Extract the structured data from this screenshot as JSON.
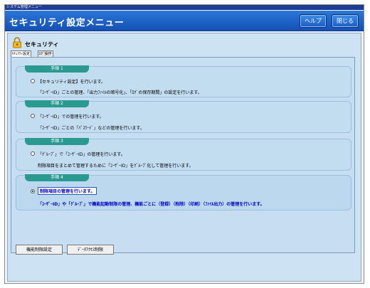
{
  "window": {
    "caption": "システム管理メニュー",
    "title": "セキュリティ設定メニュー"
  },
  "header": {
    "help_label": "ヘルプ",
    "close_label": "閉じる"
  },
  "section": {
    "title": "セキュリティ"
  },
  "tabs": [
    {
      "label": "ｾｷｭﾘﾃｨ設定"
    },
    {
      "label": "ﾛｸﾞ操作"
    }
  ],
  "steps": [
    {
      "tab": "手順 1",
      "line1": "【セキュリティ設定】を行います。",
      "line2": "「ﾕｰｻﾞｰID」ごとの管理、「出力ﾌｧｲﾙの暗号化」、「ﾛｸﾞの保存期間」の設定を行います。",
      "checked": false
    },
    {
      "tab": "手順 2",
      "line1": "「ﾕｰｻﾞｰID」での管理を行います。",
      "line2": "「ﾕｰｻﾞｰID」ごとの「ﾊﾟｽﾜｰﾄﾞ」などの管理を行います。",
      "checked": false
    },
    {
      "tab": "手順 3",
      "line1": "「ｸﾞﾙｰﾌﾟ」で「ﾕｰｻﾞｰID」の管理を行います。",
      "line2": "制限項目をまとめて管理するために「ﾕｰｻﾞｰID」をｸﾞﾙｰﾌﾟ化して管理を行います。",
      "checked": false
    },
    {
      "tab": "手順 4",
      "line1": "制限項目の管理を行います。",
      "line2": "「ﾕｰｻﾞｰID」や「ｸﾞﾙｰﾌﾟ」で機能起動制限の管理、機能ごとに（登録）（削除）（印刷）（ﾌｧｲﾙ出力）の管理を行います。",
      "checked": true
    }
  ],
  "buttons": {
    "func_limit": "機能制限設定",
    "data_access_limit": "ﾃﾞｰﾀｱｸｾｽ制限"
  },
  "colors": {
    "header": "#1e64c8",
    "panel": "#cde3f4",
    "step_tab": "#2a9a90"
  },
  "icons": {
    "section": "lock-icon"
  }
}
